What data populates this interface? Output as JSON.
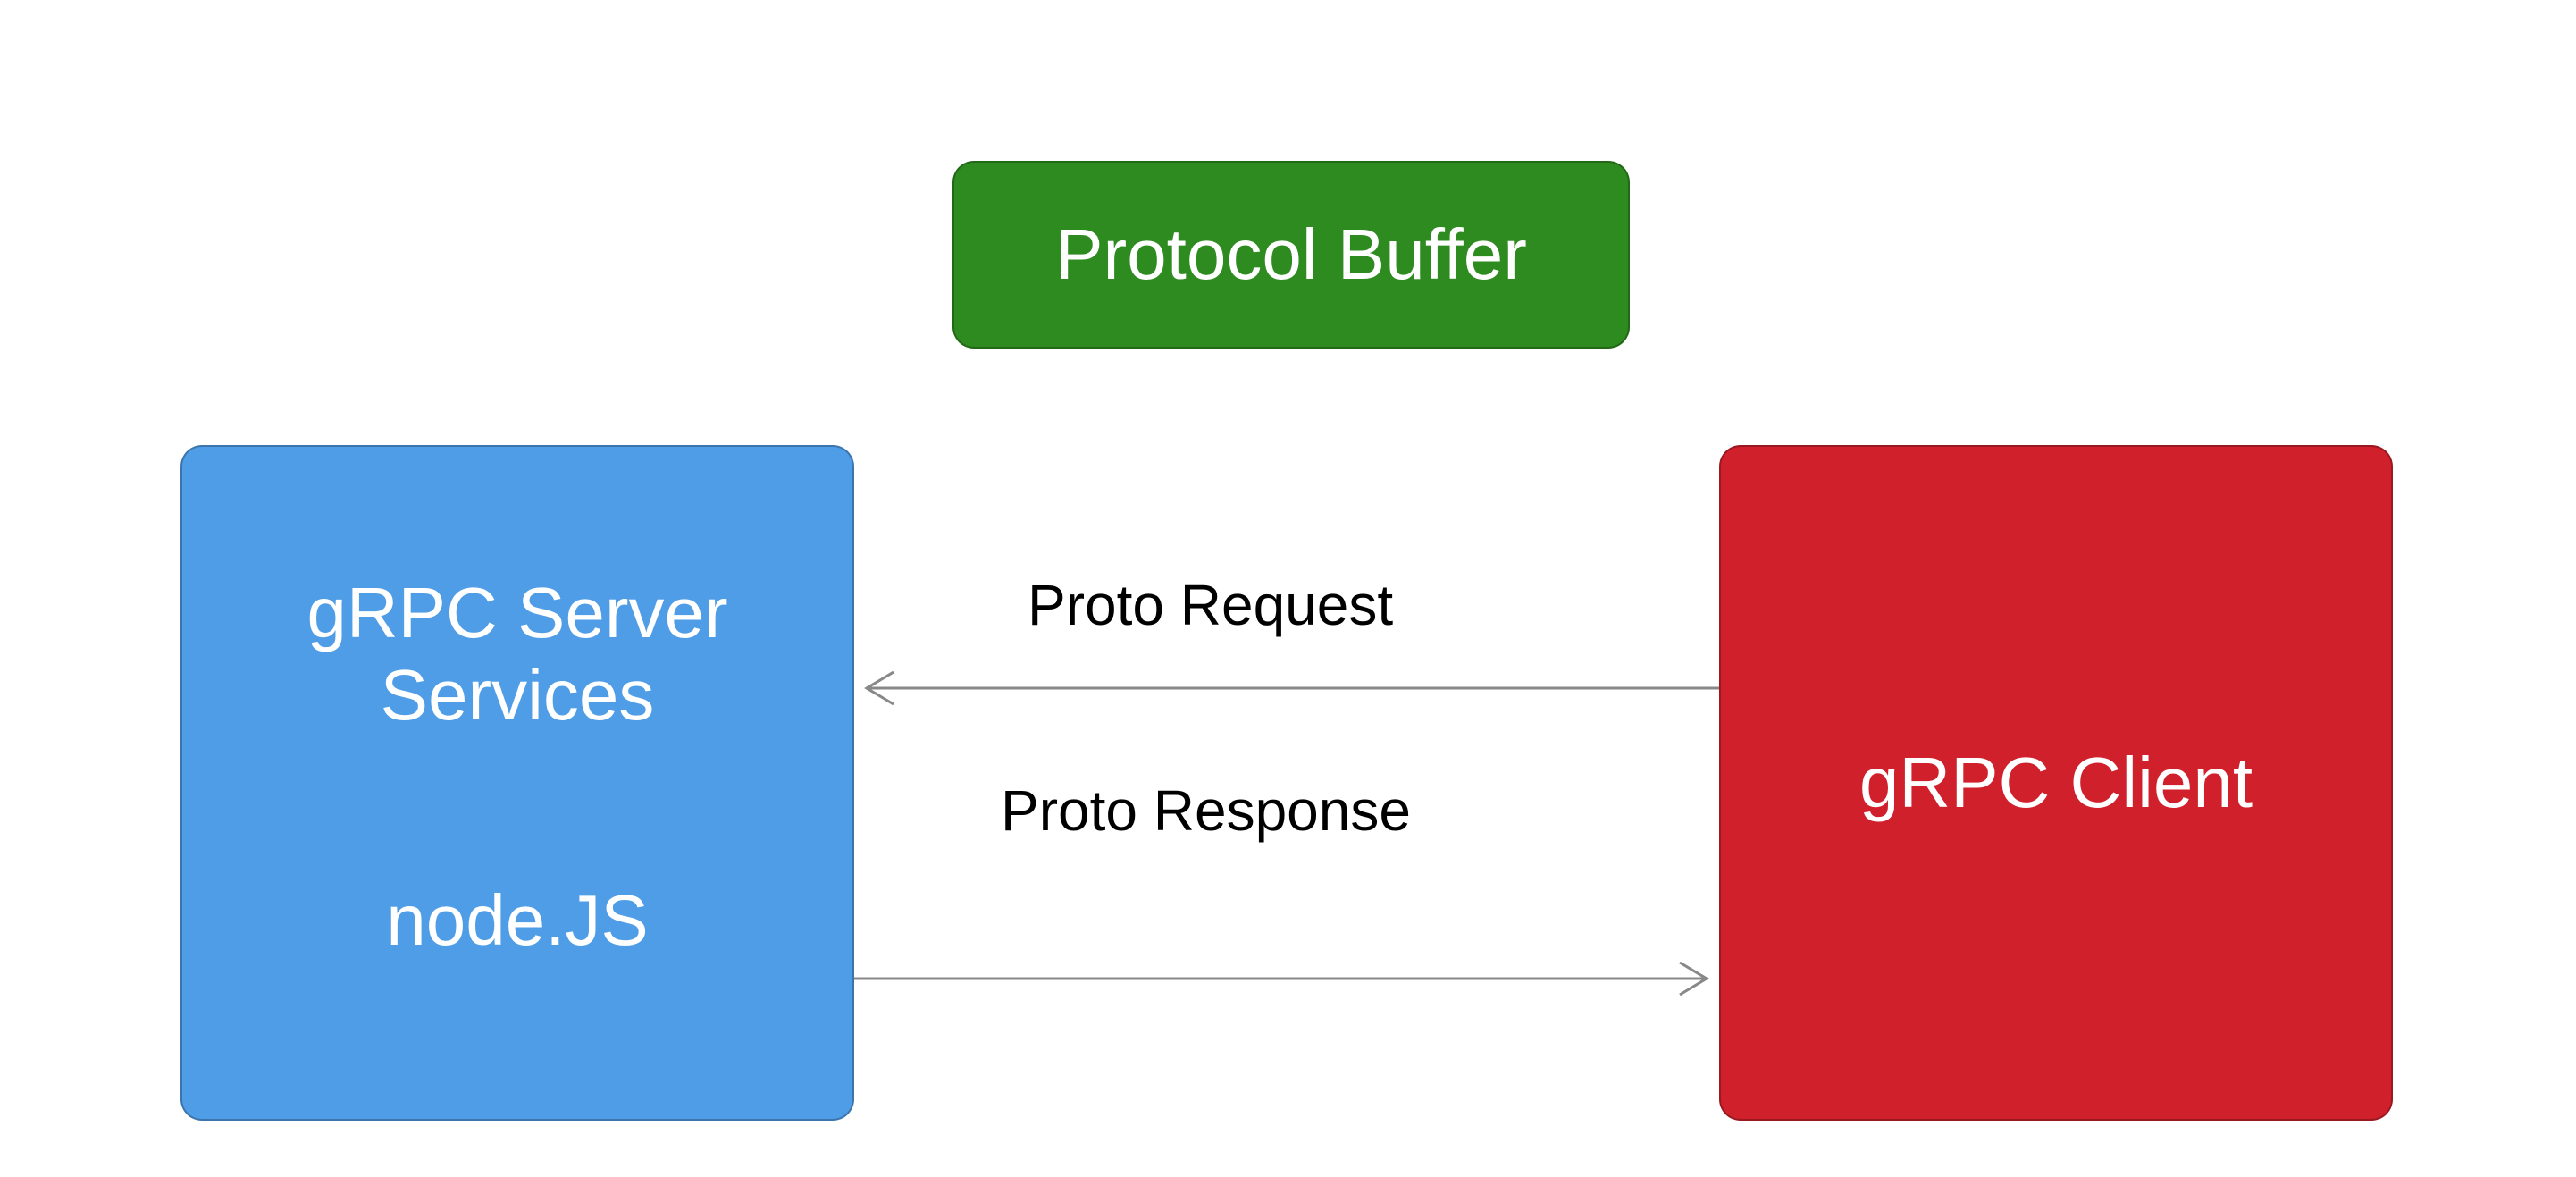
{
  "boxes": {
    "protocol_buffer": {
      "label": "Protocol Buffer",
      "color": "#2e8b1f"
    },
    "grpc_server": {
      "title_line1": "gRPC Server",
      "title_line2": "Services",
      "subtitle": "node.JS",
      "color": "#4f9de6"
    },
    "grpc_client": {
      "label": "gRPC Client",
      "color": "#d0202c"
    }
  },
  "arrows": {
    "request": {
      "label": "Proto Request",
      "from": "grpc_client",
      "to": "grpc_server"
    },
    "response": {
      "label": "Proto Response",
      "from": "grpc_server",
      "to": "grpc_client"
    }
  }
}
